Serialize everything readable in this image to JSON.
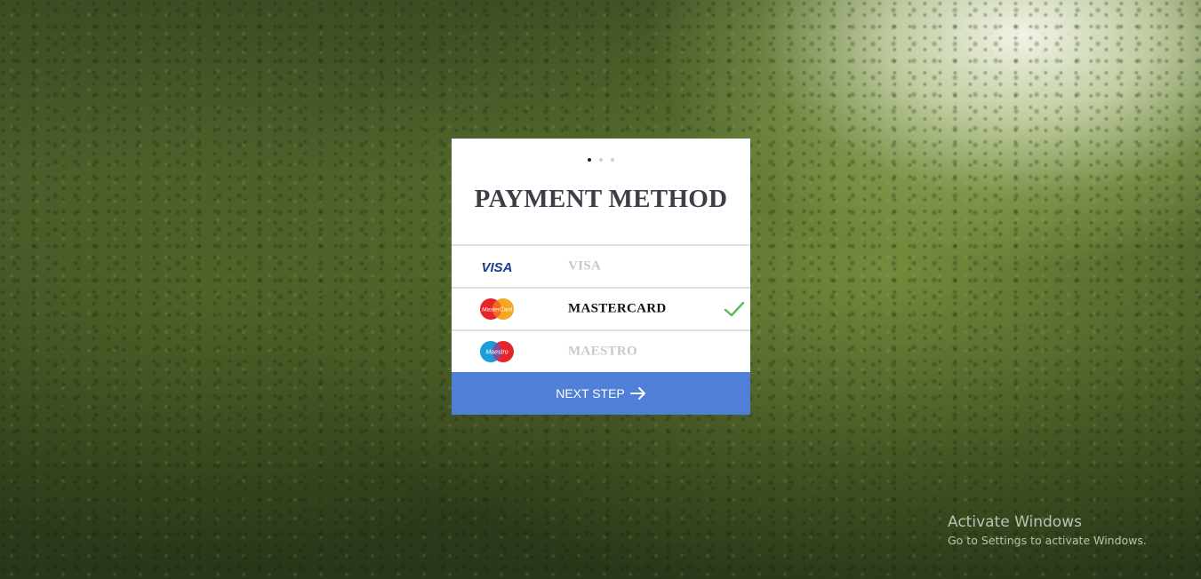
{
  "card": {
    "title": "PAYMENT METHOD",
    "steps": {
      "total": 3,
      "active": 1
    },
    "options": [
      {
        "name": "VISA",
        "logo_text": "VISA",
        "icon": "visa-logo",
        "selected": false
      },
      {
        "name": "MASTERCARD",
        "logo_text": "MasterCard",
        "icon": "mastercard-logo",
        "selected": true
      },
      {
        "name": "MAESTRO",
        "logo_text": "Maestro",
        "icon": "maestro-logo",
        "selected": false
      }
    ],
    "next_button": {
      "label": "NEXT STEP",
      "icon": "arrow-right-icon"
    }
  },
  "watermark": {
    "line1": "Activate Windows",
    "line2": "Go to Settings to activate Windows."
  },
  "colors": {
    "button": "#4f7fd6",
    "check": "#5cb85c",
    "title": "#3a3f48",
    "unselected_label": "#c8c8c8"
  }
}
